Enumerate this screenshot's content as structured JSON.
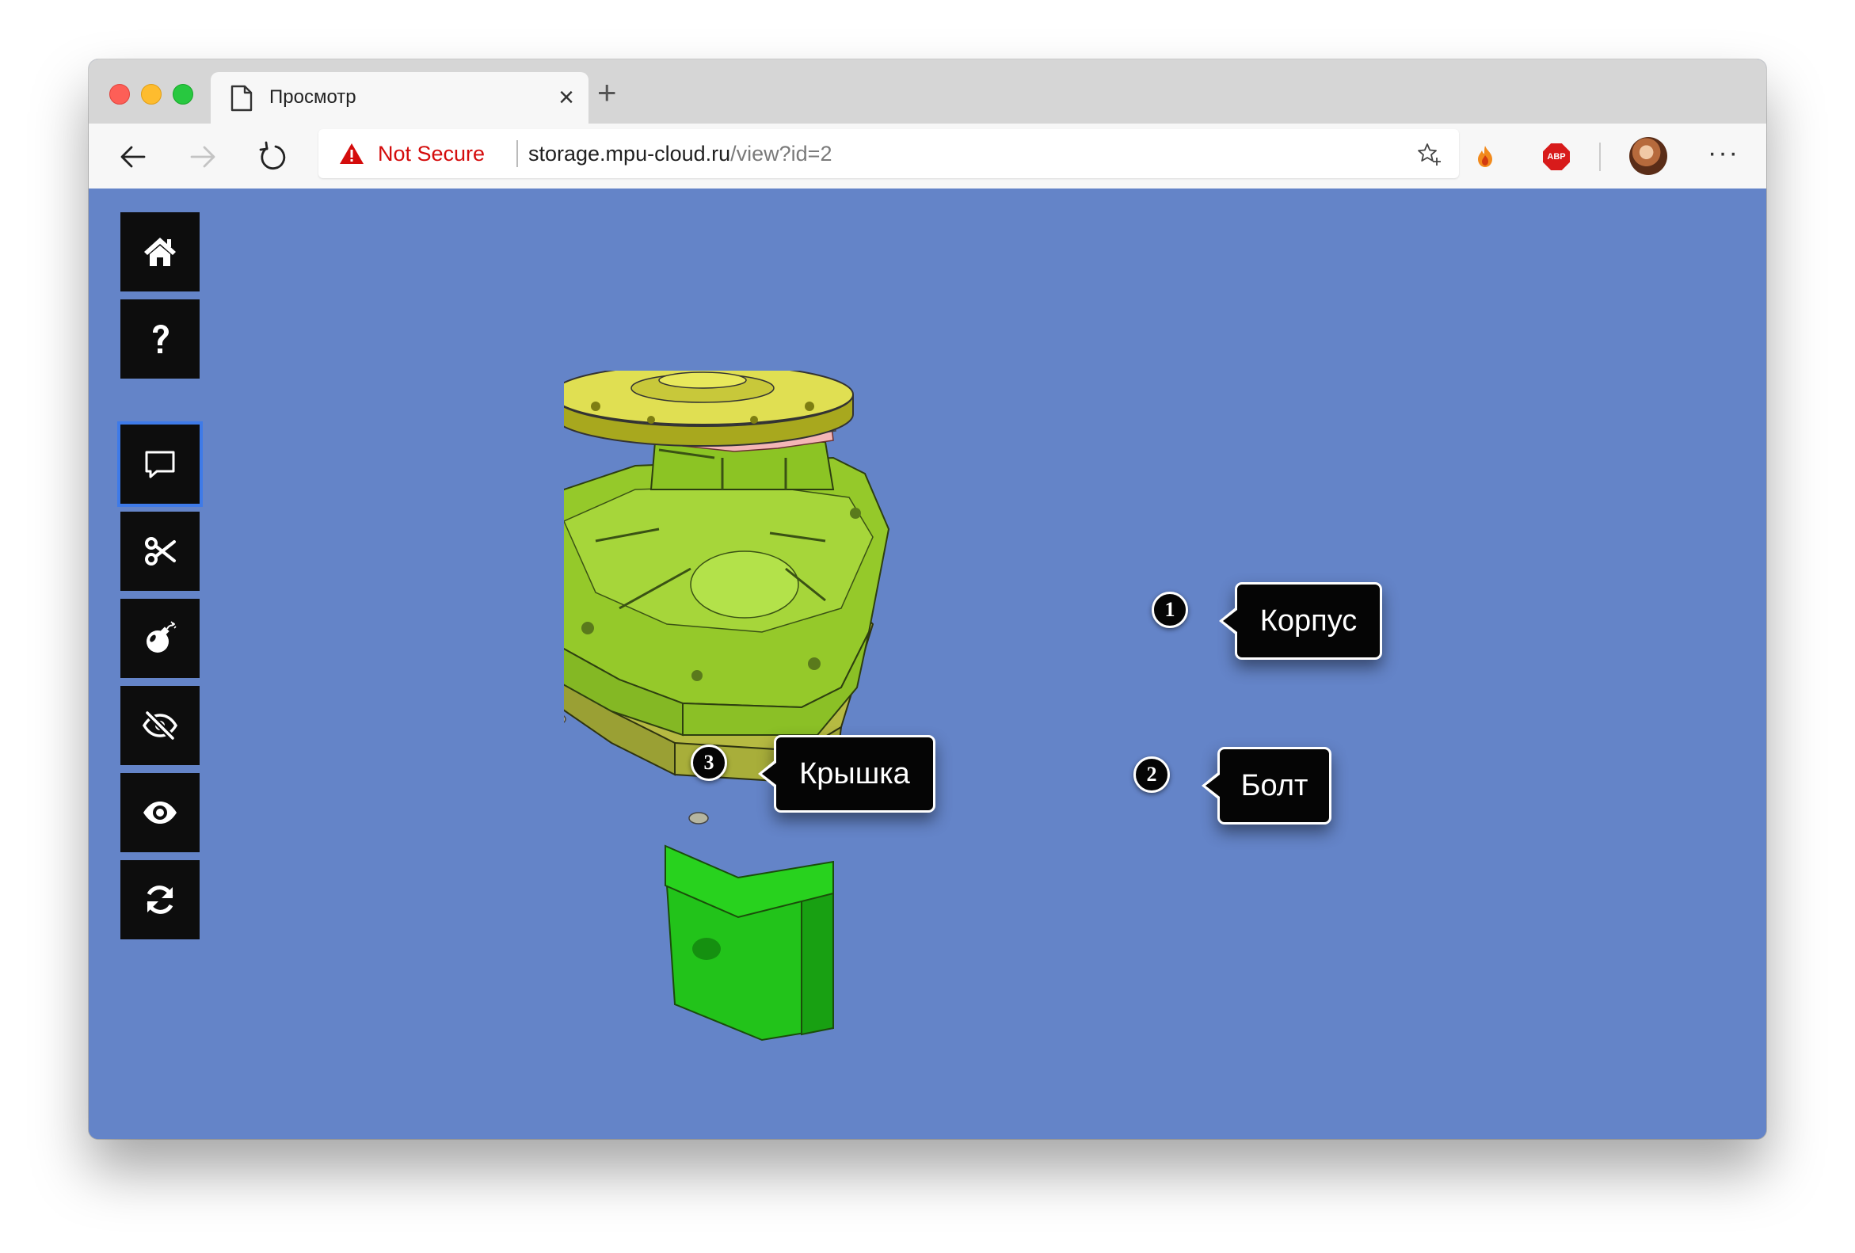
{
  "browser": {
    "tab_title": "Просмотр",
    "security_label": "Not Secure",
    "url_host": "storage.mpu-cloud.ru",
    "url_path": "/view?id=2",
    "extensions": [
      {
        "name": "fire-extension",
        "icon": "fire-icon"
      },
      {
        "name": "adblock-plus",
        "label": "ABP",
        "icon": "abp-icon"
      }
    ]
  },
  "viewer": {
    "background_color": "#6484c8",
    "toolbar": [
      {
        "name": "home",
        "icon": "home-icon"
      },
      {
        "name": "help",
        "icon": "question-icon"
      },
      {
        "name": "comment",
        "icon": "comment-icon",
        "active": true
      },
      {
        "name": "cut",
        "icon": "scissors-icon"
      },
      {
        "name": "explode",
        "icon": "bomb-icon"
      },
      {
        "name": "hide",
        "icon": "eye-slash-icon"
      },
      {
        "name": "show",
        "icon": "eye-icon"
      },
      {
        "name": "reset",
        "icon": "refresh-icon"
      }
    ],
    "annotations": [
      {
        "number": "1",
        "label": "Корпус"
      },
      {
        "number": "2",
        "label": "Болт"
      },
      {
        "number": "3",
        "label": "Крышка"
      }
    ]
  }
}
